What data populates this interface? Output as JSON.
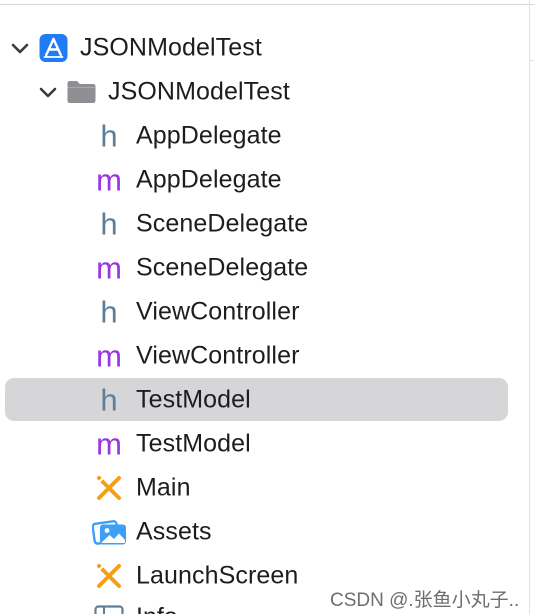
{
  "navigator": {
    "project": {
      "label": "JSONModelTest",
      "icon": "xcode-project-icon",
      "expanded": true
    },
    "group": {
      "label": "JSONModelTest",
      "icon": "folder-icon",
      "expanded": true
    },
    "files": [
      {
        "label": "AppDelegate",
        "icon": "header-file-icon",
        "glyph": "h"
      },
      {
        "label": "AppDelegate",
        "icon": "objc-impl-file-icon",
        "glyph": "m"
      },
      {
        "label": "SceneDelegate",
        "icon": "header-file-icon",
        "glyph": "h"
      },
      {
        "label": "SceneDelegate",
        "icon": "objc-impl-file-icon",
        "glyph": "m"
      },
      {
        "label": "ViewController",
        "icon": "header-file-icon",
        "glyph": "h"
      },
      {
        "label": "ViewController",
        "icon": "objc-impl-file-icon",
        "glyph": "m"
      },
      {
        "label": "TestModel",
        "icon": "header-file-icon",
        "glyph": "h",
        "selected": true
      },
      {
        "label": "TestModel",
        "icon": "objc-impl-file-icon",
        "glyph": "m"
      },
      {
        "label": "Main",
        "icon": "storyboard-icon"
      },
      {
        "label": "Assets",
        "icon": "asset-catalog-icon"
      },
      {
        "label": "LaunchScreen",
        "icon": "storyboard-icon"
      },
      {
        "label": "Info",
        "icon": "plist-icon"
      }
    ]
  },
  "watermark": "CSDN @.张鱼小丸子..",
  "colors": {
    "header_glyph": "#5f7e97",
    "impl_glyph": "#9a34e1",
    "storyboard": "#f4a017",
    "assets": "#3d9ff6",
    "project": "#1f7cf4",
    "folder": "#8e8e93",
    "selection": "#d6d6d8"
  }
}
